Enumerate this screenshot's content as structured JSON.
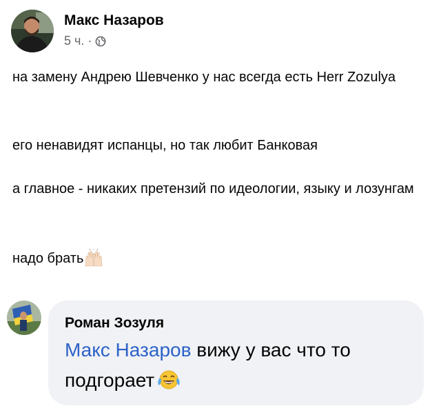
{
  "post": {
    "author": "Макс Назаров",
    "time": "5 ч.",
    "separator": "·",
    "privacy_icon": "globe-icon",
    "paragraphs": [
      "на замену Андрею Шевченко у нас всегда есть Herr Zozulya",
      "его ненавидят испанцы, но так любит Банковая",
      "а главное - никаких претензий по идеологии, языку и лозунгам",
      "надо брать"
    ],
    "last_emoji": "raising-hands-emoji"
  },
  "comment": {
    "author": "Роман Зозуля",
    "mention": "Макс Назаров",
    "text_line1": " вижу у вас что то",
    "text_line2": "подгорает",
    "emoji": "tears-of-joy-emoji"
  },
  "colors": {
    "text": "#050505",
    "meta": "#65676b",
    "mention": "#2d62c9",
    "bubble": "#f0f2f5"
  }
}
